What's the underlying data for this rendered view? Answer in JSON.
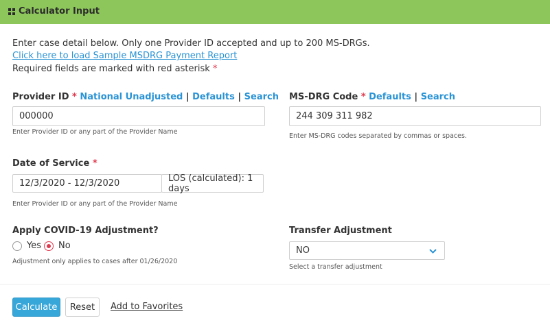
{
  "header": {
    "title": "Calculator Input",
    "icon": "grid-icon"
  },
  "intro": {
    "line1": "Enter case detail below. Only one Provider ID accepted and up to 200 MS-DRGs.",
    "sample_link": "Click here to load Sample MSDRG Payment Report",
    "required_note": "Required fields are marked with red asterisk",
    "asterisk": "*"
  },
  "provider": {
    "label": "Provider ID",
    "asterisk": "*",
    "link_national": "National Unadjusted",
    "link_defaults": "Defaults",
    "link_search": "Search",
    "separator": "|",
    "value": "000000",
    "hint": "Enter Provider ID or any part of the Provider Name"
  },
  "msdrg": {
    "label": "MS-DRG Code",
    "asterisk": "*",
    "link_defaults": "Defaults",
    "link_search": "Search",
    "separator": "|",
    "value": "244 309 311 982",
    "hint": "Enter MS-DRG codes separated by commas or spaces."
  },
  "date_of_service": {
    "label": "Date of Service",
    "asterisk": "*",
    "value": "12/3/2020 - 12/3/2020",
    "los": "LOS (calculated): 1 days",
    "hint": "Enter Provider ID or any part of the Provider Name"
  },
  "covid": {
    "label": "Apply COVID-19 Adjustment?",
    "options": [
      "Yes",
      "No"
    ],
    "selected": "No",
    "hint": "Adjustment only applies to cases after 01/26/2020"
  },
  "transfer": {
    "label": "Transfer Adjustment",
    "value": "NO",
    "hint": "Select a transfer adjustment"
  },
  "actions": {
    "calculate": "Calculate",
    "reset": "Reset",
    "favorites": "Add to Favorites"
  },
  "colors": {
    "header_bg": "#8dc65b",
    "link": "#2a93d5",
    "required": "#e03a4e",
    "primary_button": "#37a6d9"
  }
}
